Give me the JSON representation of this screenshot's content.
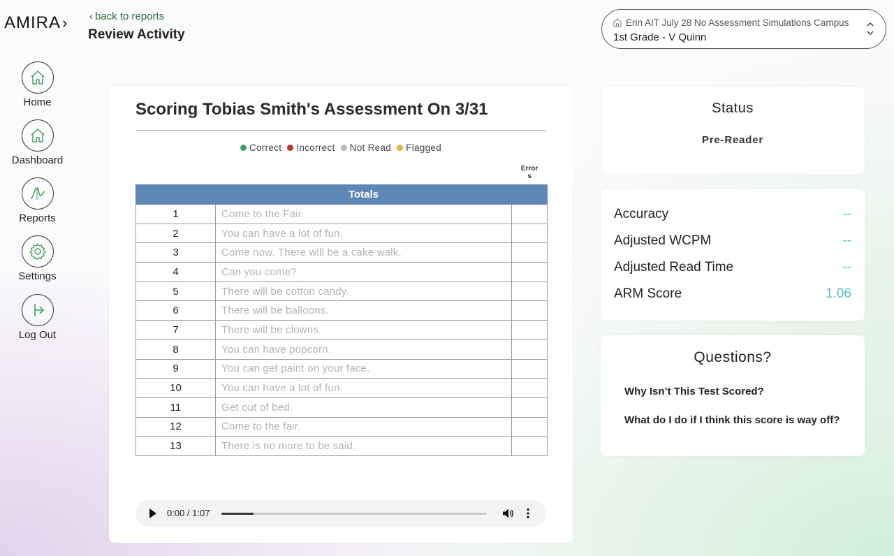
{
  "brand": {
    "logo_text": "AMIRA",
    "logo_chevron": "›"
  },
  "header": {
    "back_link": "back to reports",
    "page_title": "Review Activity",
    "campus_select": {
      "campus": "Erin AIT July 28 No Assessment Simulations Campus",
      "class": "1st Grade - V Quinn"
    }
  },
  "sidebar": {
    "items": [
      {
        "label": "Home",
        "icon": "home-icon"
      },
      {
        "label": "Dashboard",
        "icon": "dashboard-icon"
      },
      {
        "label": "Reports",
        "icon": "reports-icon"
      },
      {
        "label": "Settings",
        "icon": "gear-icon"
      },
      {
        "label": "Log Out",
        "icon": "logout-icon"
      }
    ]
  },
  "assessment": {
    "title": "Scoring Tobias Smith's Assessment On 3/31",
    "legend": [
      {
        "label": "Correct",
        "color": "#3e9a68"
      },
      {
        "label": "Incorrect",
        "color": "#b8352a"
      },
      {
        "label": "Not Read",
        "color": "#b9b9b9"
      },
      {
        "label": "Flagged",
        "color": "#e0b43a"
      }
    ],
    "errors_header": "Errors",
    "table_header": "Totals",
    "rows": [
      {
        "num": "1",
        "text": "Come to the Fair."
      },
      {
        "num": "2",
        "text": "You can have a lot of fun."
      },
      {
        "num": "3",
        "text": "Come now. There will be a cake walk."
      },
      {
        "num": "4",
        "text": "Can you come?"
      },
      {
        "num": "5",
        "text": "There will be cotton candy."
      },
      {
        "num": "6",
        "text": "There will be balloons."
      },
      {
        "num": "7",
        "text": "There will be clowns."
      },
      {
        "num": "8",
        "text": "You can have popcorn."
      },
      {
        "num": "9",
        "text": "You can get paint on your face."
      },
      {
        "num": "10",
        "text": "You can have a lot of fun."
      },
      {
        "num": "11",
        "text": "Get out of bed."
      },
      {
        "num": "12",
        "text": "Come to the fair."
      },
      {
        "num": "13",
        "text": "There is no more to be said."
      }
    ],
    "audio": {
      "time": "0:00 / 1:07",
      "progress": 0.12
    }
  },
  "status": {
    "title": "Status",
    "value": "Pre-Reader"
  },
  "metrics": [
    {
      "label": "Accuracy",
      "value": "--"
    },
    {
      "label": "Adjusted WCPM",
      "value": "--"
    },
    {
      "label": "Adjusted Read Time",
      "value": "--"
    },
    {
      "label": "ARM Score",
      "value": "1.06"
    }
  ],
  "questions": {
    "title": "Questions?",
    "links": [
      "Why Isn’t This Test Scored?",
      "What do I do if I think this score is way off?"
    ]
  },
  "colors": {
    "accent_teal": "#5ac2c6",
    "table_header": "#5f87b6",
    "back_link": "#2e6b3b"
  }
}
